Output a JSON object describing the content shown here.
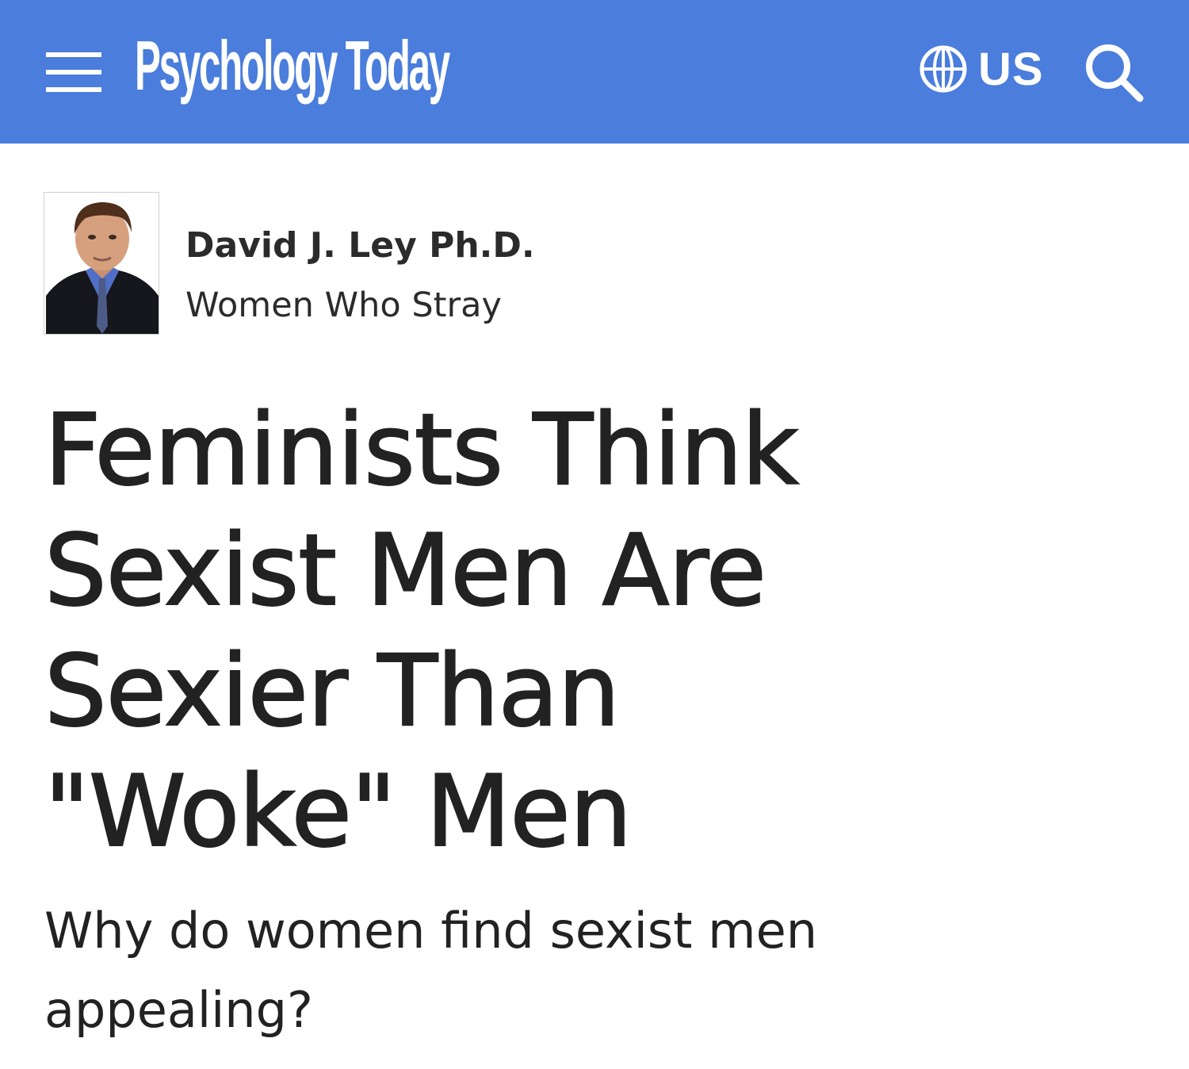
{
  "header": {
    "brand": "Psychology Today",
    "region_label": "US",
    "icons": [
      "hamburger-menu-icon",
      "globe-icon",
      "search-icon"
    ],
    "background_color": "#4a7ddc"
  },
  "author": {
    "name": "David J. Ley Ph.D.",
    "blog": "Women Who Stray"
  },
  "article": {
    "headline": "Feminists Think Sexist Men Are Sexier Than \"Woke\" Men",
    "subtitle": "Why do women find sexist men appealing?"
  }
}
